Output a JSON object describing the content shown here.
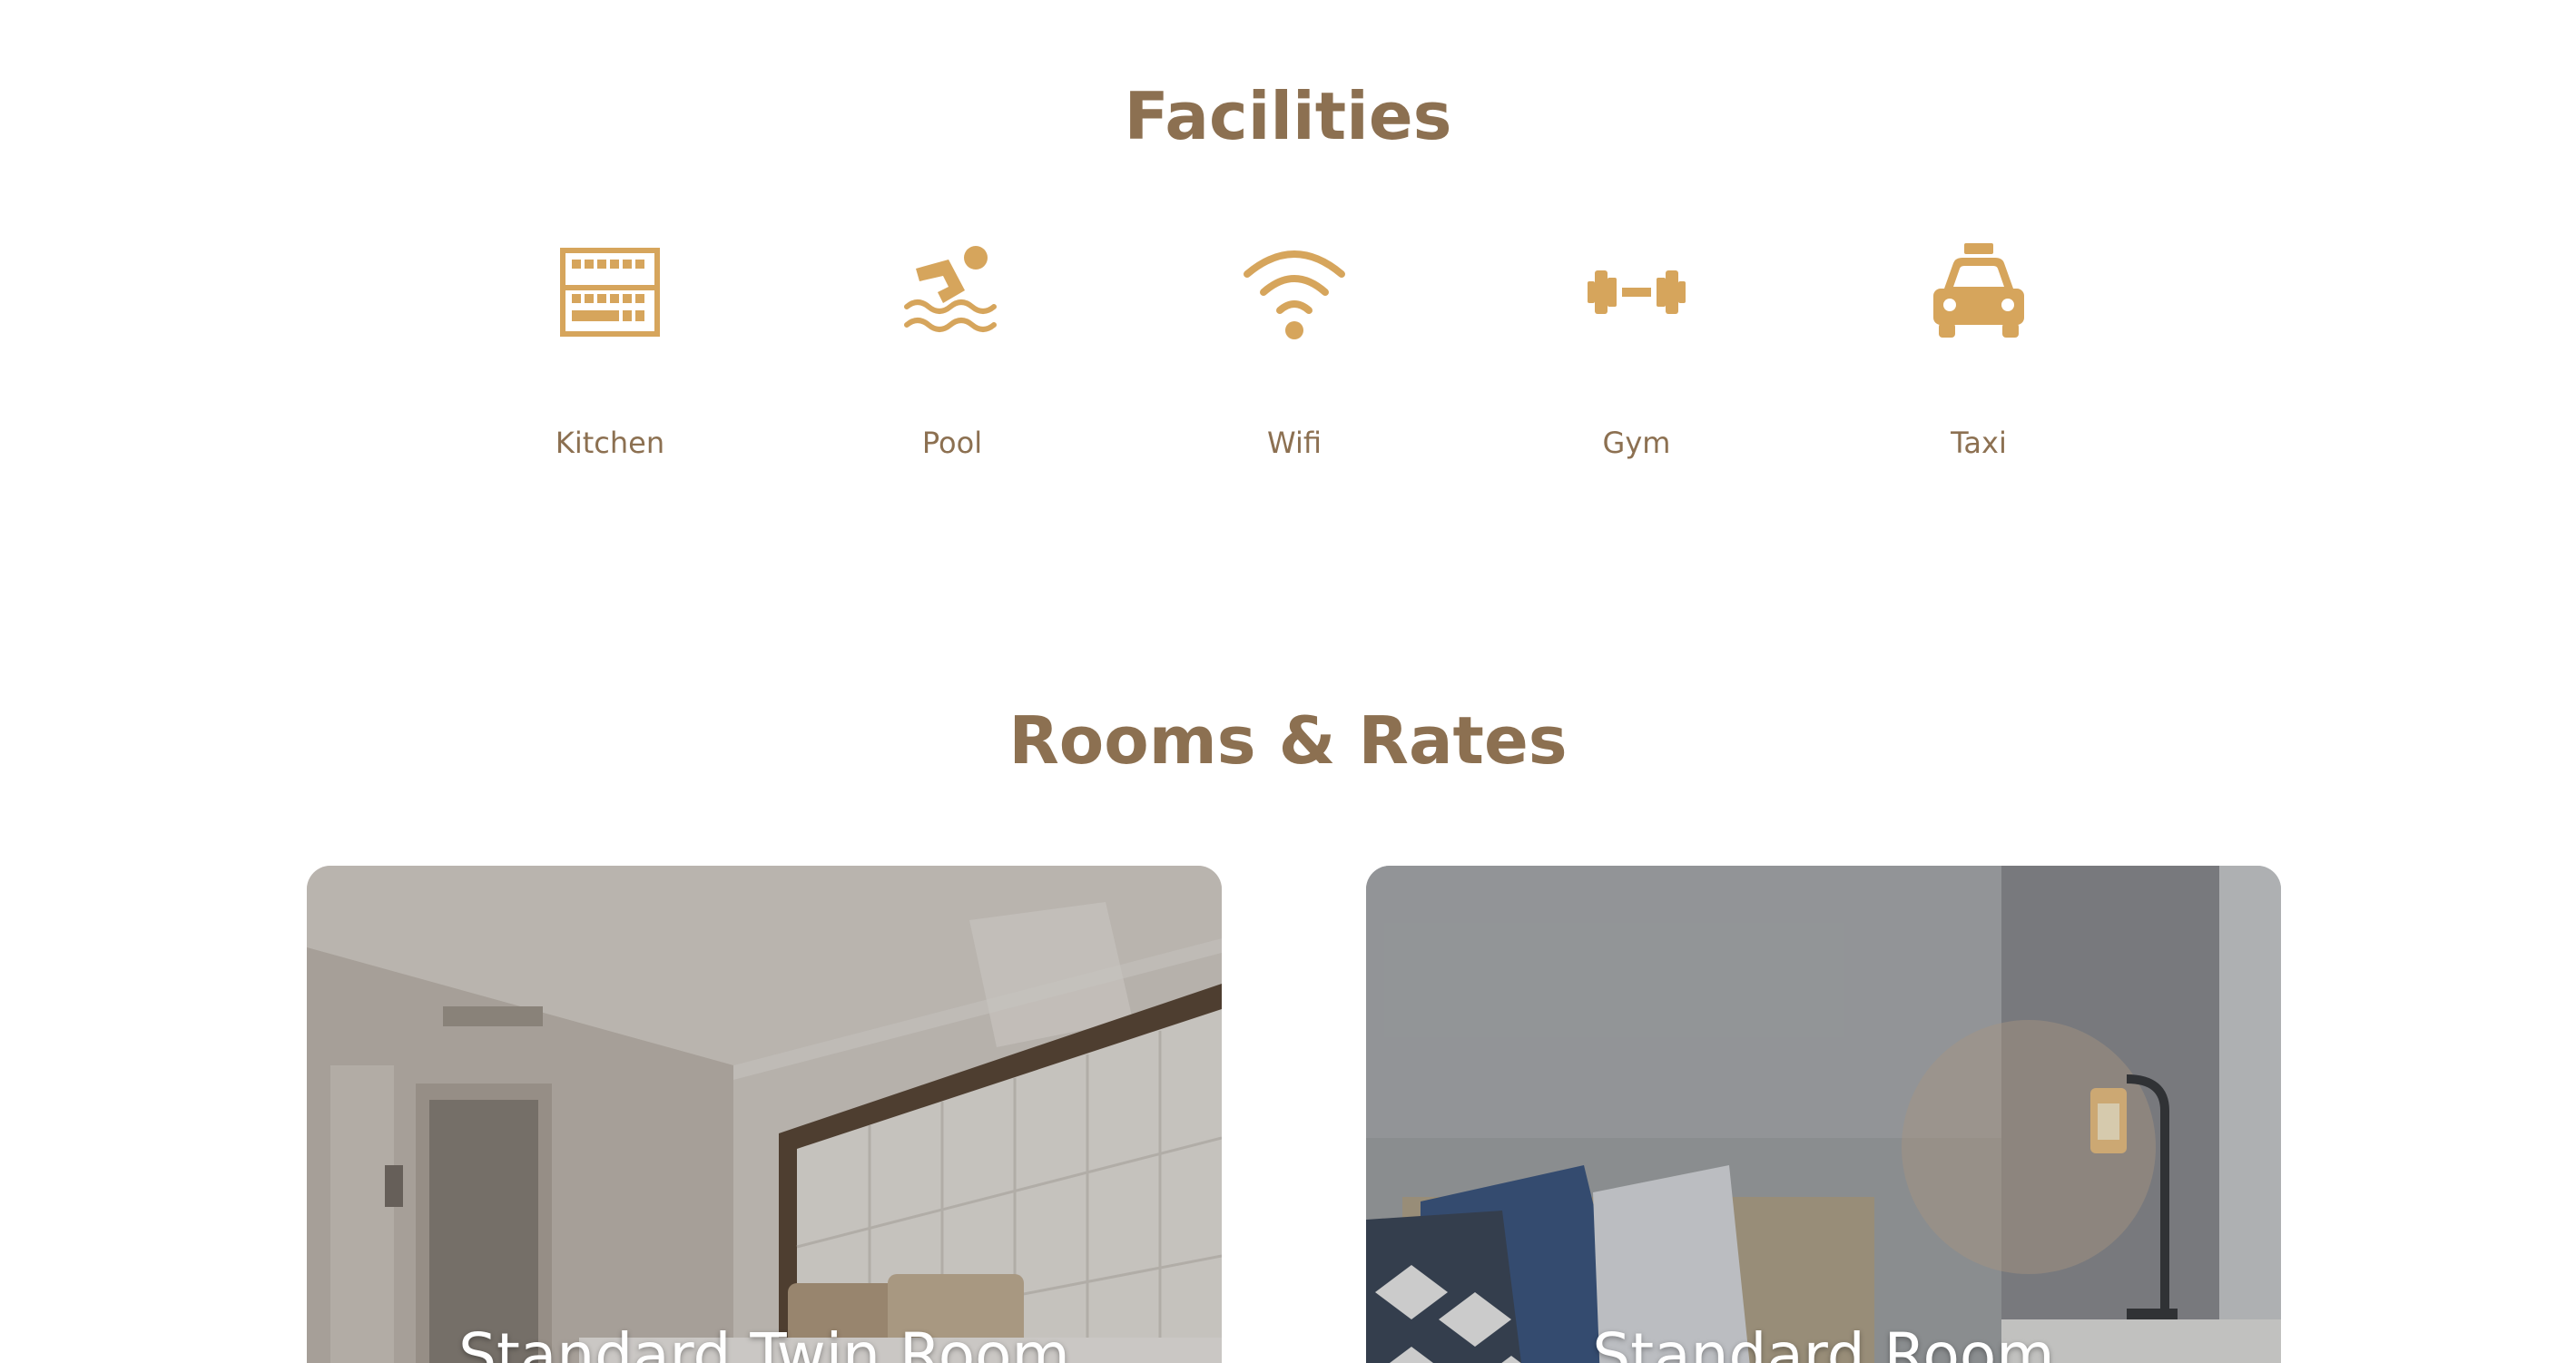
{
  "facilities": {
    "title": "Facilities",
    "items": [
      {
        "label": "Kitchen",
        "icon": "kitchen-icon"
      },
      {
        "label": "Pool",
        "icon": "swimmer-icon"
      },
      {
        "label": "Wifi",
        "icon": "wifi-icon"
      },
      {
        "label": "Gym",
        "icon": "dumbbell-icon"
      },
      {
        "label": "Taxi",
        "icon": "taxi-icon"
      }
    ]
  },
  "rooms": {
    "title": "Rooms & Rates",
    "items": [
      {
        "name": "Standard Twin Room"
      },
      {
        "name": "Standard Room"
      }
    ]
  },
  "colors": {
    "title": "#8c7051",
    "icon": "#d6a55c",
    "label": "#8c7051"
  }
}
